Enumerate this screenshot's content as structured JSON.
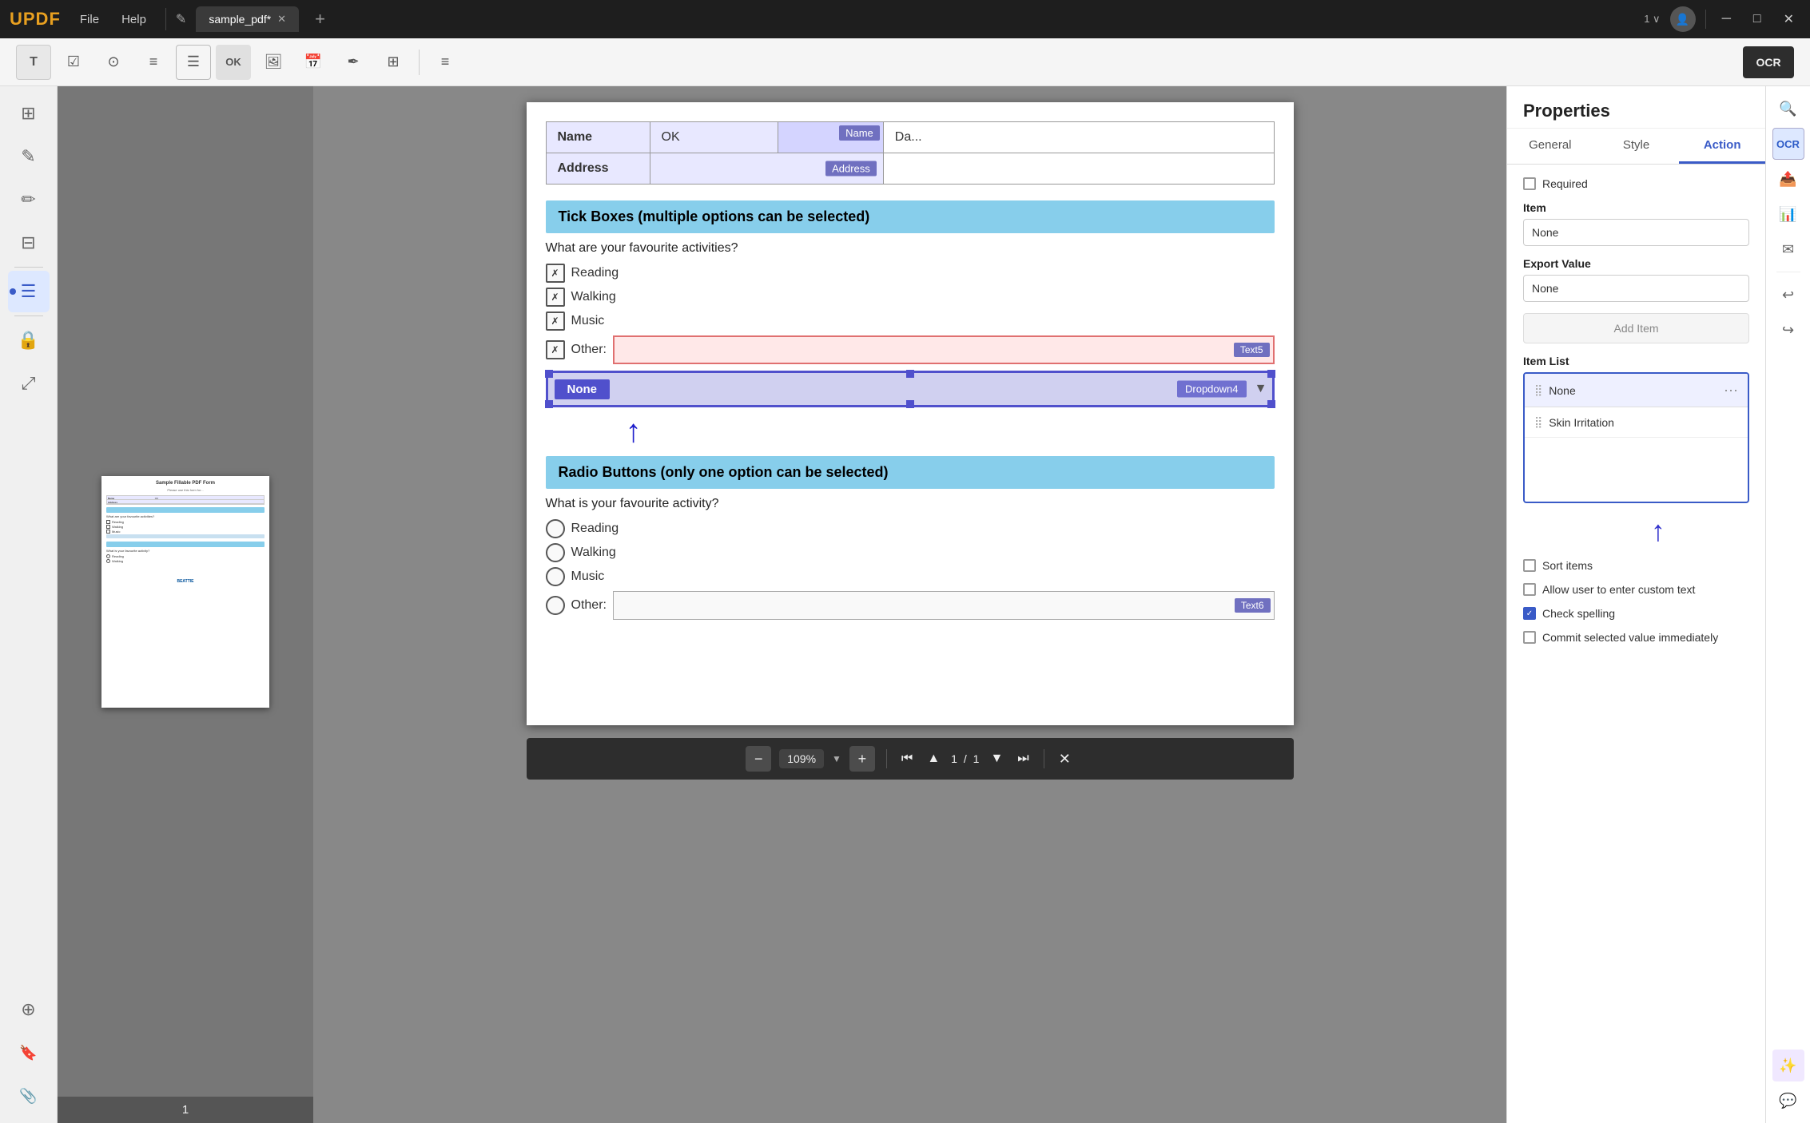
{
  "app": {
    "logo": "UPDF",
    "menu": [
      "File",
      "Help"
    ],
    "tab_name": "sample_pdf*",
    "window_controls": [
      "minimize",
      "maximize",
      "close"
    ]
  },
  "toolbar": {
    "tools": [
      "text-field",
      "checkbox",
      "radio",
      "list-box",
      "combo-box",
      "ok-button",
      "image",
      "date",
      "signature",
      "grid"
    ],
    "ocr_label": "OCR"
  },
  "left_sidebar": {
    "items": [
      {
        "name": "pages",
        "icon": "⊞"
      },
      {
        "name": "annotate",
        "icon": "✎"
      },
      {
        "name": "edit",
        "icon": "✏"
      },
      {
        "name": "organize",
        "icon": "⊟"
      },
      {
        "name": "forms",
        "icon": "☰",
        "active": true
      },
      {
        "name": "protect",
        "icon": "🔒"
      },
      {
        "name": "layers",
        "icon": "⊕"
      },
      {
        "name": "bookmark",
        "icon": "🔖"
      },
      {
        "name": "attachment",
        "icon": "📎"
      }
    ]
  },
  "pdf_thumbnail": {
    "page_number": "1"
  },
  "pdf_content": {
    "form_table": {
      "rows": [
        {
          "label": "Name",
          "value": "OK",
          "tag": "Name",
          "tag2": "Da..."
        },
        {
          "label": "Address",
          "value": "",
          "tag": "Address"
        }
      ]
    },
    "sections": [
      {
        "title": "Tick Boxes (multiple options can be selected)",
        "question": "What are your favourite activities?",
        "options": [
          "Reading",
          "Walking",
          "Music",
          "Other:"
        ],
        "text_field_tag": "Text5",
        "dropdown": {
          "value": "None",
          "tag": "Dropdown4"
        }
      },
      {
        "title": "Radio Buttons (only one option can be selected)",
        "question": "What is your favourite activity?",
        "options": [
          "Reading",
          "Walking",
          "Music",
          "Other:"
        ],
        "text_field_tag": "Text6"
      }
    ]
  },
  "zoom_bar": {
    "zoom_value": "109%",
    "page_current": "1",
    "page_separator": "/",
    "page_total": "1"
  },
  "properties_panel": {
    "title": "Properties",
    "tabs": [
      "General",
      "Style",
      "Action"
    ],
    "active_tab": "Action",
    "required_label": "Required",
    "item_section": "Item",
    "item_value": "None",
    "export_value_section": "Export Value",
    "export_value": "None",
    "add_item_label": "Add Item",
    "item_list_section": "Item List",
    "item_list": [
      {
        "text": "None",
        "active": true
      },
      {
        "text": "Skin Irritation"
      }
    ],
    "sort_items_label": "Sort items",
    "sort_items_checked": false,
    "allow_custom_label": "Allow user to enter custom text",
    "allow_custom_checked": false,
    "check_spelling_label": "Check spelling",
    "check_spelling_checked": true,
    "commit_label": "Commit selected value immediately",
    "commit_checked": false
  },
  "right_sidebar": {
    "icons": [
      "search",
      "scan",
      "upload",
      "email",
      "export",
      "undo",
      "redo"
    ]
  }
}
